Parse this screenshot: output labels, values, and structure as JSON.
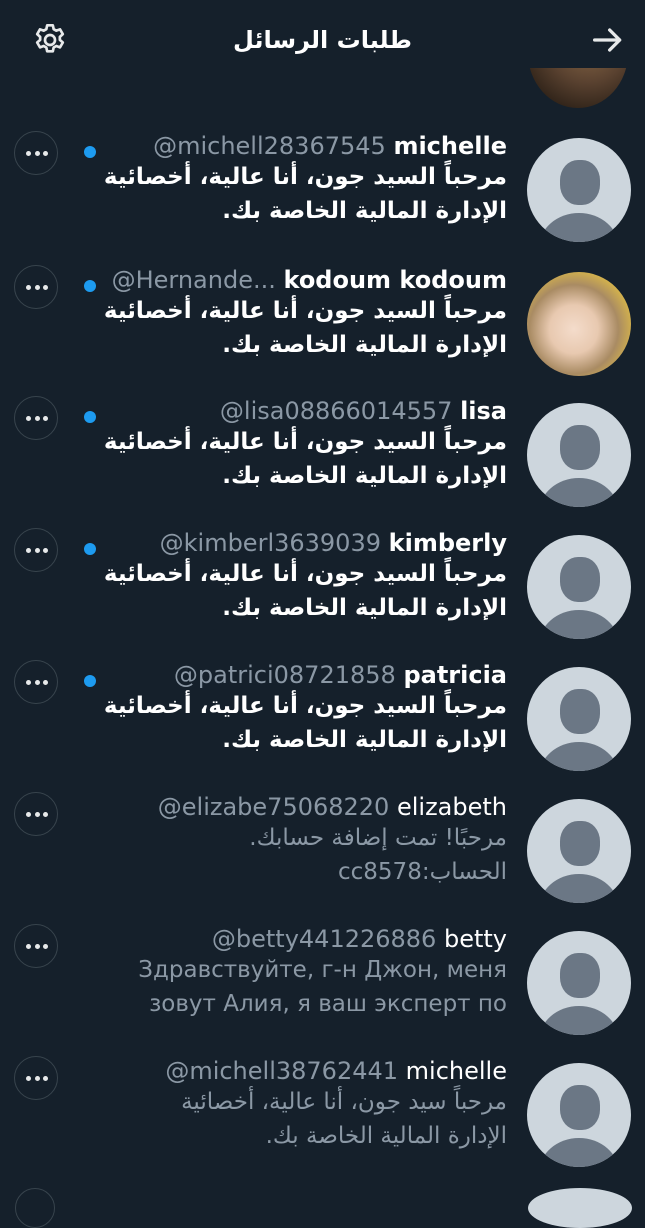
{
  "header": {
    "title": "طلبات الرسائل"
  },
  "requests": [
    {
      "username": "michelle",
      "handle": "@michell28367545",
      "line1": "مرحباً السيد جون، أنا عالية، أخصائية",
      "line2": "الإدارة المالية الخاصة بك.",
      "unread": true,
      "avatar": "default"
    },
    {
      "username": "kodoum kodoum",
      "handle": "@Hernande...",
      "line1": "مرحباً السيد جون، أنا عالية، أخصائية",
      "line2": "الإدارة المالية الخاصة بك.",
      "unread": true,
      "avatar": "photo"
    },
    {
      "username": "lisa",
      "handle": "@lisa08866014557",
      "line1": "مرحباً السيد جون، أنا عالية، أخصائية",
      "line2": "الإدارة المالية الخاصة بك.",
      "unread": true,
      "avatar": "default"
    },
    {
      "username": "kimberly",
      "handle": "@kimberl3639039",
      "line1": "مرحباً السيد جون، أنا عالية، أخصائية",
      "line2": "الإدارة المالية الخاصة بك.",
      "unread": true,
      "avatar": "default"
    },
    {
      "username": "patricia",
      "handle": "@patrici08721858",
      "line1": "مرحباً السيد جون، أنا عالية، أخصائية",
      "line2": "الإدارة المالية الخاصة بك.",
      "unread": true,
      "avatar": "default"
    },
    {
      "username": "elizabeth",
      "handle": "@elizabe75068220",
      "line1": "مرحبًا! تمت إضافة حسابك.",
      "line2": "الحساب:cc8578",
      "unread": false,
      "avatar": "default"
    },
    {
      "username": "betty",
      "handle": "@betty441226886",
      "line1": "Здравствуйте, г-н Джон, меня",
      "line2": "зовут Алия, я ваш эксперт по",
      "unread": false,
      "avatar": "default"
    },
    {
      "username": "michelle",
      "handle": "@michell38762441",
      "line1": "مرحباً سيد جون، أنا عالية، أخصائية",
      "line2": "الإدارة المالية الخاصة بك.",
      "unread": false,
      "avatar": "default"
    }
  ],
  "colors": {
    "background": "#15202b",
    "accent_blue": "#1d9bf0",
    "secondary_text": "#8b98a5",
    "border": "#38444d"
  },
  "icons": {
    "settings": "gear-icon",
    "back": "arrow-right-icon",
    "more": "more-horizontal-icon",
    "unread": "unread-dot-icon"
  }
}
